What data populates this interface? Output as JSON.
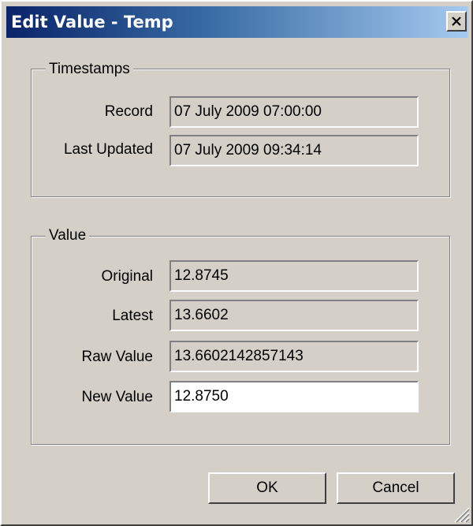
{
  "window": {
    "title": "Edit Value - Temp",
    "close_glyph": "close-icon"
  },
  "timestamps": {
    "legend": "Timestamps",
    "record_label": "Record",
    "record_value": "07 July 2009 07:00:00",
    "last_updated_label": "Last Updated",
    "last_updated_value": "07 July 2009 09:34:14"
  },
  "value": {
    "legend": "Value",
    "original_label": "Original",
    "original_value": "12.8745",
    "latest_label": "Latest",
    "latest_value": "13.6602",
    "raw_label": "Raw Value",
    "raw_value": "13.6602142857143",
    "new_label": "New Value",
    "new_value": "12.8750"
  },
  "buttons": {
    "ok_label": "OK",
    "cancel_label": "Cancel"
  },
  "colors": {
    "dialog_face": "#d4d0c8",
    "title_gradient_start": "#0a246a",
    "title_gradient_end": "#a6caf0",
    "editable_field": "#ffffff"
  }
}
